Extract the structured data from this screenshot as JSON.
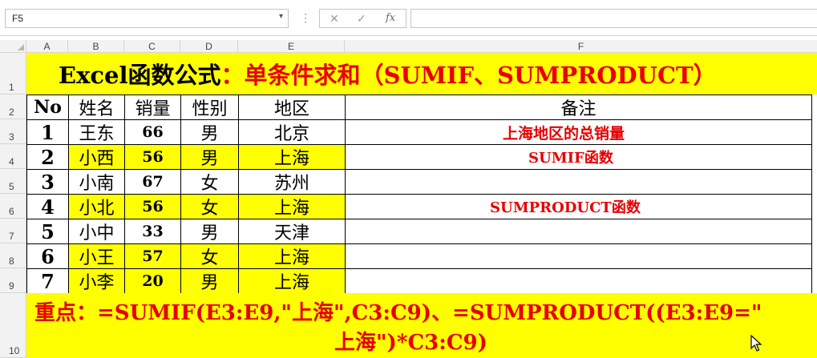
{
  "formula_bar": {
    "name_box": "F5",
    "cancel_icon": "✕",
    "enter_icon": "✓",
    "fx_label": "fx",
    "formula": ""
  },
  "columns": [
    "A",
    "B",
    "C",
    "D",
    "E",
    "F"
  ],
  "rows": [
    "1",
    "2",
    "3",
    "4",
    "5",
    "6",
    "7",
    "8",
    "9",
    "10"
  ],
  "title": {
    "prefix": "Excel函数公式",
    "colon": "：",
    "main": "单条件求和（SUMIF、SUMPRODUCT）"
  },
  "table": {
    "headers": [
      "No",
      "姓名",
      "销量",
      "性别",
      "地区",
      "备注"
    ],
    "rows": [
      {
        "no": "1",
        "name": "王东",
        "sales": "66",
        "gender": "男",
        "region": "北京",
        "note": "上海地区的总销量"
      },
      {
        "no": "2",
        "name": "小西",
        "sales": "56",
        "gender": "男",
        "region": "上海",
        "note": "SUMIF函数"
      },
      {
        "no": "3",
        "name": "小南",
        "sales": "67",
        "gender": "女",
        "region": "苏州",
        "note": ""
      },
      {
        "no": "4",
        "name": "小北",
        "sales": "56",
        "gender": "女",
        "region": "上海",
        "note": "SUMPRODUCT函数"
      },
      {
        "no": "5",
        "name": "小中",
        "sales": "33",
        "gender": "男",
        "region": "天津",
        "note": ""
      },
      {
        "no": "6",
        "name": "小王",
        "sales": "57",
        "gender": "女",
        "region": "上海",
        "note": ""
      },
      {
        "no": "7",
        "name": "小李",
        "sales": "20",
        "gender": "男",
        "region": "上海",
        "note": ""
      }
    ]
  },
  "key_point": {
    "label": "重点：",
    "line1": "=SUMIF(E3:E9,\"上海\",C3:C9)、=SUMPRODUCT((E3:E9=\"",
    "line2": "上海\")*C3:C9)"
  },
  "colors": {
    "highlight": "#ffff00",
    "accent_red": "#e60000",
    "header_gray": "#f2f2f2"
  }
}
